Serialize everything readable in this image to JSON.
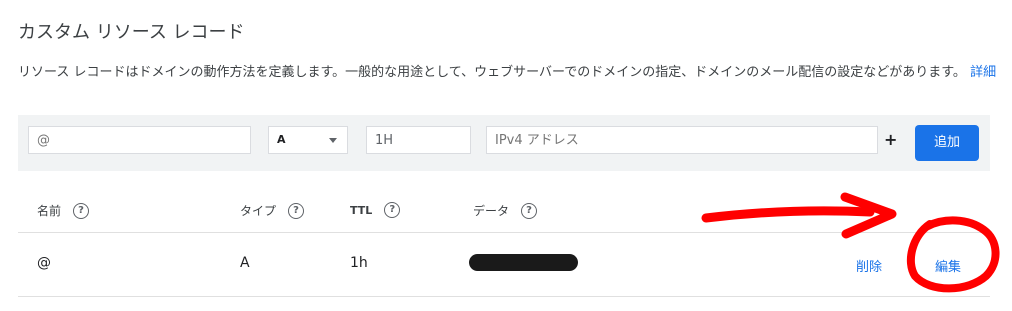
{
  "page": {
    "title": "カスタム リソース レコード",
    "description": "リソース レコードはドメインの動作方法を定義します。一般的な用途として、ウェブサーバーでのドメインの指定、ドメインのメール配信の設定などがあります。",
    "learn_more": "詳細"
  },
  "form": {
    "name_placeholder": "@",
    "type_value": "A",
    "ttl_value": "1H",
    "data_placeholder": "IPv4 アドレス",
    "plus_label": "+",
    "add_label": "追加"
  },
  "table": {
    "headers": {
      "name": "名前",
      "type": "タイプ",
      "ttl": "TTL",
      "data": "データ"
    },
    "help_label": "?",
    "rows": [
      {
        "name": "@",
        "type": "A",
        "ttl": "1h",
        "delete_label": "削除",
        "edit_label": "編集"
      }
    ]
  },
  "colors": {
    "accent": "#1a73e8",
    "annotation": "#ff0000"
  }
}
